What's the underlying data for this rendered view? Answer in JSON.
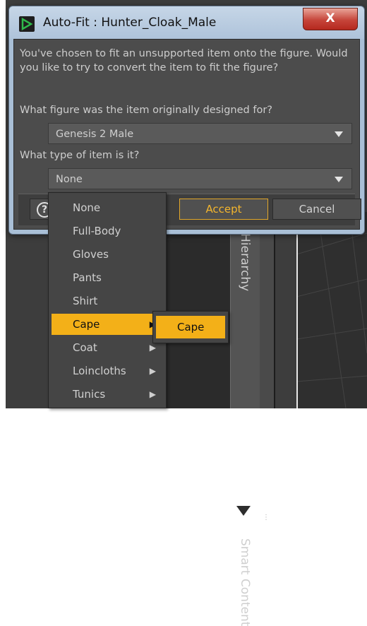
{
  "window": {
    "title": "Auto-Fit : Hunter_Cloak_Male",
    "close_glyph": "X",
    "icon": "daz-app-icon"
  },
  "dialog": {
    "message": "You've chosen to fit an unsupported item onto the figure. Would you like to try to convert the item to fit the figure?",
    "figure_question": "What figure was the item originally designed for?",
    "figure_value": "Genesis 2 Male",
    "type_question": "What type of item is it?",
    "type_value": "None",
    "help_glyph": "?",
    "accept_label": "Accept",
    "cancel_label": "Cancel"
  },
  "dropdown": {
    "items": [
      {
        "label": "None",
        "has_submenu": false
      },
      {
        "label": "Full-Body",
        "has_submenu": false
      },
      {
        "label": "Gloves",
        "has_submenu": false
      },
      {
        "label": "Pants",
        "has_submenu": false
      },
      {
        "label": "Shirt",
        "has_submenu": false
      },
      {
        "label": "Cape",
        "has_submenu": true
      },
      {
        "label": "Coat",
        "has_submenu": true
      },
      {
        "label": "Loincloths",
        "has_submenu": true
      },
      {
        "label": "Tunics",
        "has_submenu": true
      }
    ],
    "selected": "Cape",
    "submenu_items": [
      "Cape"
    ],
    "submenu_glyph": "▶"
  },
  "background": {
    "side_tab_1": "Hierarchy",
    "side_tab_2": "Smart Content"
  },
  "colors": {
    "accent": "#f3b018",
    "accept_text": "#f3b52d",
    "close_button": "#c6453a"
  }
}
